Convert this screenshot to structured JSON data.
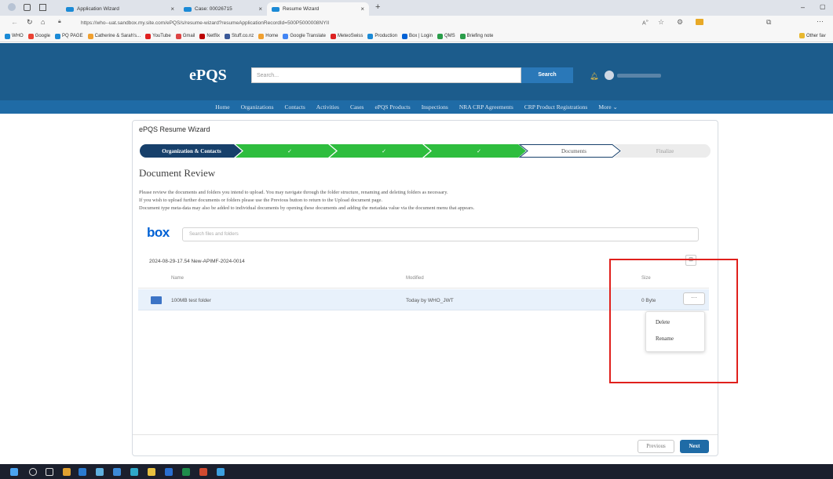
{
  "browser": {
    "tabs": [
      {
        "label": "Application Wizard",
        "active": false
      },
      {
        "label": "Case: 00026715",
        "active": false
      },
      {
        "label": "Resume Wizard",
        "active": true
      }
    ],
    "new_tab_glyph": "+",
    "url": "https://who--uat.sandbox.my.site.com/ePQS/s/resume-wizard?resumeApplicationRecordId=500P5000008NYII",
    "bookmarks": [
      "WHO",
      "Google",
      "PQ PAGE",
      "Catherine & Sarah's...",
      "YouTube",
      "Gmail",
      "Netflix",
      "Stuff.co.nz",
      "Home",
      "Google Translate",
      "MeteoSwiss",
      "Production",
      "Box | Login",
      "QMS",
      "Briefing note"
    ],
    "other_favorites": "Other fav"
  },
  "header": {
    "logo": "ePQS",
    "search_placeholder": "Search...",
    "search_button": "Search"
  },
  "nav": [
    "Home",
    "Organizations",
    "Contacts",
    "Activities",
    "Cases",
    "ePQS Products",
    "Inspections",
    "NRA CRP Agreements",
    "CRP Product Registrations",
    "More ⌄"
  ],
  "wizard": {
    "title": "ePQS Resume Wizard",
    "steps": [
      {
        "label": "Organization & Contacts",
        "state": "current"
      },
      {
        "label": "✓",
        "state": "complete"
      },
      {
        "label": "✓",
        "state": "complete"
      },
      {
        "label": "✓",
        "state": "complete"
      },
      {
        "label": "Documents",
        "state": "active-outline"
      },
      {
        "label": "Finalize",
        "state": "pending"
      }
    ],
    "section_title": "Document Review",
    "description": [
      "Please review the documents and folders you intend to upload. You may navigate through the folder structure, renaming and deleting folders as necessary.",
      "If you wish to upload further documents or folders please use the Previous button to return to the Upload document page.",
      "Document type meta-data may also be added to individual documents by opening these documents and adding the metadata value via the document menu that appears."
    ]
  },
  "box": {
    "logo": "box",
    "search_placeholder": "Search files and folders",
    "breadcrumb": "2024-08-29-17.54 New-APIMF-2024-0014",
    "columns": {
      "name": "Name",
      "modified": "Modified",
      "size": "Size"
    },
    "rows": [
      {
        "name": "100MB test folder",
        "modified": "Today by WHO_JWT",
        "size": "0 Byte"
      }
    ],
    "more_label": "···",
    "menu": [
      "Delete",
      "Rename"
    ]
  },
  "footer": {
    "previous": "Previous",
    "next": "Next"
  },
  "colors": {
    "header": "#1c5c8c",
    "nav": "#1f6ba6",
    "step_current": "#17406b",
    "step_complete": "#2ebd3e",
    "highlight": "#e0201c"
  }
}
